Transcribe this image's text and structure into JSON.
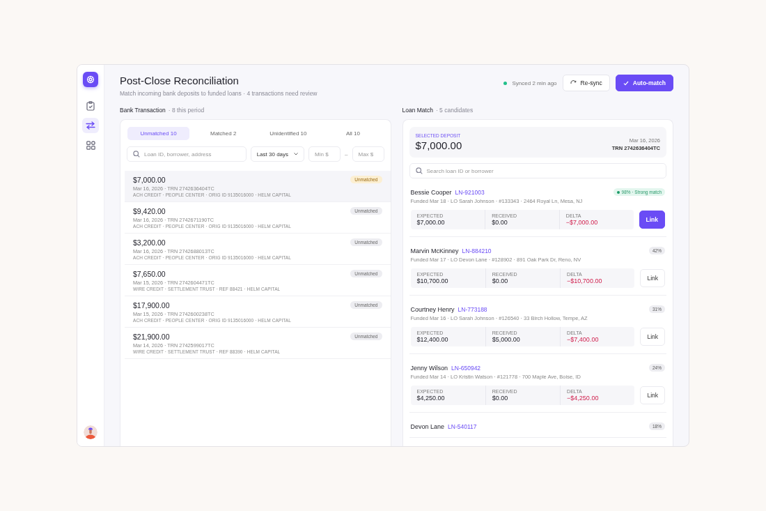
{
  "header": {
    "title": "Post-Close Reconciliation",
    "subtitle": "Match incoming bank deposits to funded loans · 4 transactions need review",
    "sync_status": "Synced 2 min ago",
    "resync_button": "Re-sync",
    "automatch_button": "Auto-match"
  },
  "sidebar": {
    "items": [
      {
        "selected": false
      },
      {
        "selected": true
      },
      {
        "selected": false
      }
    ]
  },
  "bank": {
    "title": "Bank Transaction",
    "count": "· 8 this period",
    "tabs": [
      {
        "label": "Unmatched 10",
        "selected": true
      },
      {
        "label": "Matched 2",
        "selected": false
      },
      {
        "label": "Unidentified 10",
        "selected": false
      },
      {
        "label": "All 10",
        "selected": false
      }
    ],
    "search": {
      "placeholder": "Loan ID, borrower, address"
    },
    "period": "Last 30 days",
    "min": {
      "placeholder": "Min $"
    },
    "dash": "–",
    "max": {
      "placeholder": "Max $"
    },
    "transactions": [
      {
        "amount": "$7,000.00",
        "ref": "Mar 16, 2026 · TRN 2742636404TC",
        "detail": "ACH CREDIT · PEOPLE CENTER · ORIG ID 9135016000 · HELM CAPITAL",
        "status": "Unmatched",
        "selected": true
      },
      {
        "amount": "$9,420.00",
        "ref": "Mar 16, 2026 · TRN 2742671190TC",
        "detail": "ACH CREDIT · PEOPLE CENTER · ORIG ID 9135016000 · HELM CAPITAL",
        "status": "Unmatched",
        "selected": false
      },
      {
        "amount": "$3,200.00",
        "ref": "Mar 16, 2026 · TRN 2742688013TC",
        "detail": "ACH CREDIT · PEOPLE CENTER · ORIG ID 9135016000 · HELM CAPITAL",
        "status": "Unmatched",
        "selected": false
      },
      {
        "amount": "$7,650.00",
        "ref": "Mar 15, 2026 · TRN 2742604471TC",
        "detail": "WIRE CREDIT · SETTLEMENT TRUST · REF 88421 · HELM CAPITAL",
        "status": "Unmatched",
        "selected": false
      },
      {
        "amount": "$17,900.00",
        "ref": "Mar 15, 2026 · TRN 2742600238TC",
        "detail": "ACH CREDIT · PEOPLE CENTER · ORIG ID 9135016000 · HELM CAPITAL",
        "status": "Unmatched",
        "selected": false
      },
      {
        "amount": "$21,900.00",
        "ref": "Mar 14, 2026 · TRN 2742599017TC",
        "detail": "WIRE CREDIT · SETTLEMENT TRUST · REF 88390 · HELM CAPITAL",
        "status": "Unmatched",
        "selected": false
      }
    ]
  },
  "loan": {
    "title": "Loan Match",
    "count": "· 5 candidates",
    "deposit": {
      "label": "SELECTED DEPOSIT",
      "amount": "$7,000.00",
      "date": "Mar 16, 2026",
      "trn": "TRN 2742636404TC"
    },
    "search": {
      "placeholder": "Search loan ID or borrower"
    },
    "candidates": [
      {
        "name": "Bessie Cooper",
        "loan_id": "LN-921003",
        "funded": "Funded Mar 18 · LO Sarah Johnson · #133343 · 2464 Royal Ln, Mesa, NJ",
        "score": "98% · Strong match",
        "recommended": true,
        "expected_label": "EXPECTED",
        "expected": "$7,000.00",
        "received_label": "RECEIVED",
        "received": "$0.00",
        "delta_label": "DELTA",
        "delta": "−$7,000.00",
        "link": "Link"
      },
      {
        "name": "Marvin McKinney",
        "loan_id": "LN-884210",
        "funded": "Funded Mar 17 · LO Devon Lane · #128902 · 891 Oak Park Dr, Reno, NV",
        "score": "42%",
        "recommended": false,
        "expected_label": "EXPECTED",
        "expected": "$10,700.00",
        "received_label": "RECEIVED",
        "received": "$0.00",
        "delta_label": "DELTA",
        "delta": "−$10,700.00",
        "link": "Link"
      },
      {
        "name": "Courtney Henry",
        "loan_id": "LN-773188",
        "funded": "Funded Mar 16 · LO Sarah Johnson · #126540 · 33 Birch Hollow, Tempe, AZ",
        "score": "31%",
        "recommended": false,
        "expected_label": "EXPECTED",
        "expected": "$12,400.00",
        "received_label": "RECEIVED",
        "received": "$5,000.00",
        "delta_label": "DELTA",
        "delta": "−$7,400.00",
        "link": "Link"
      },
      {
        "name": "Jenny Wilson",
        "loan_id": "LN-650942",
        "funded": "Funded Mar 14 · LO Kristin Watson · #121778 · 700 Maple Ave, Boise, ID",
        "score": "24%",
        "recommended": false,
        "expected_label": "EXPECTED",
        "expected": "$4,250.00",
        "received_label": "RECEIVED",
        "received": "$0.00",
        "delta_label": "DELTA",
        "delta": "−$4,250.00",
        "link": "Link"
      },
      {
        "name": "Devon Lane",
        "loan_id": "LN-540117",
        "score": "18%",
        "recommended": false
      }
    ]
  }
}
